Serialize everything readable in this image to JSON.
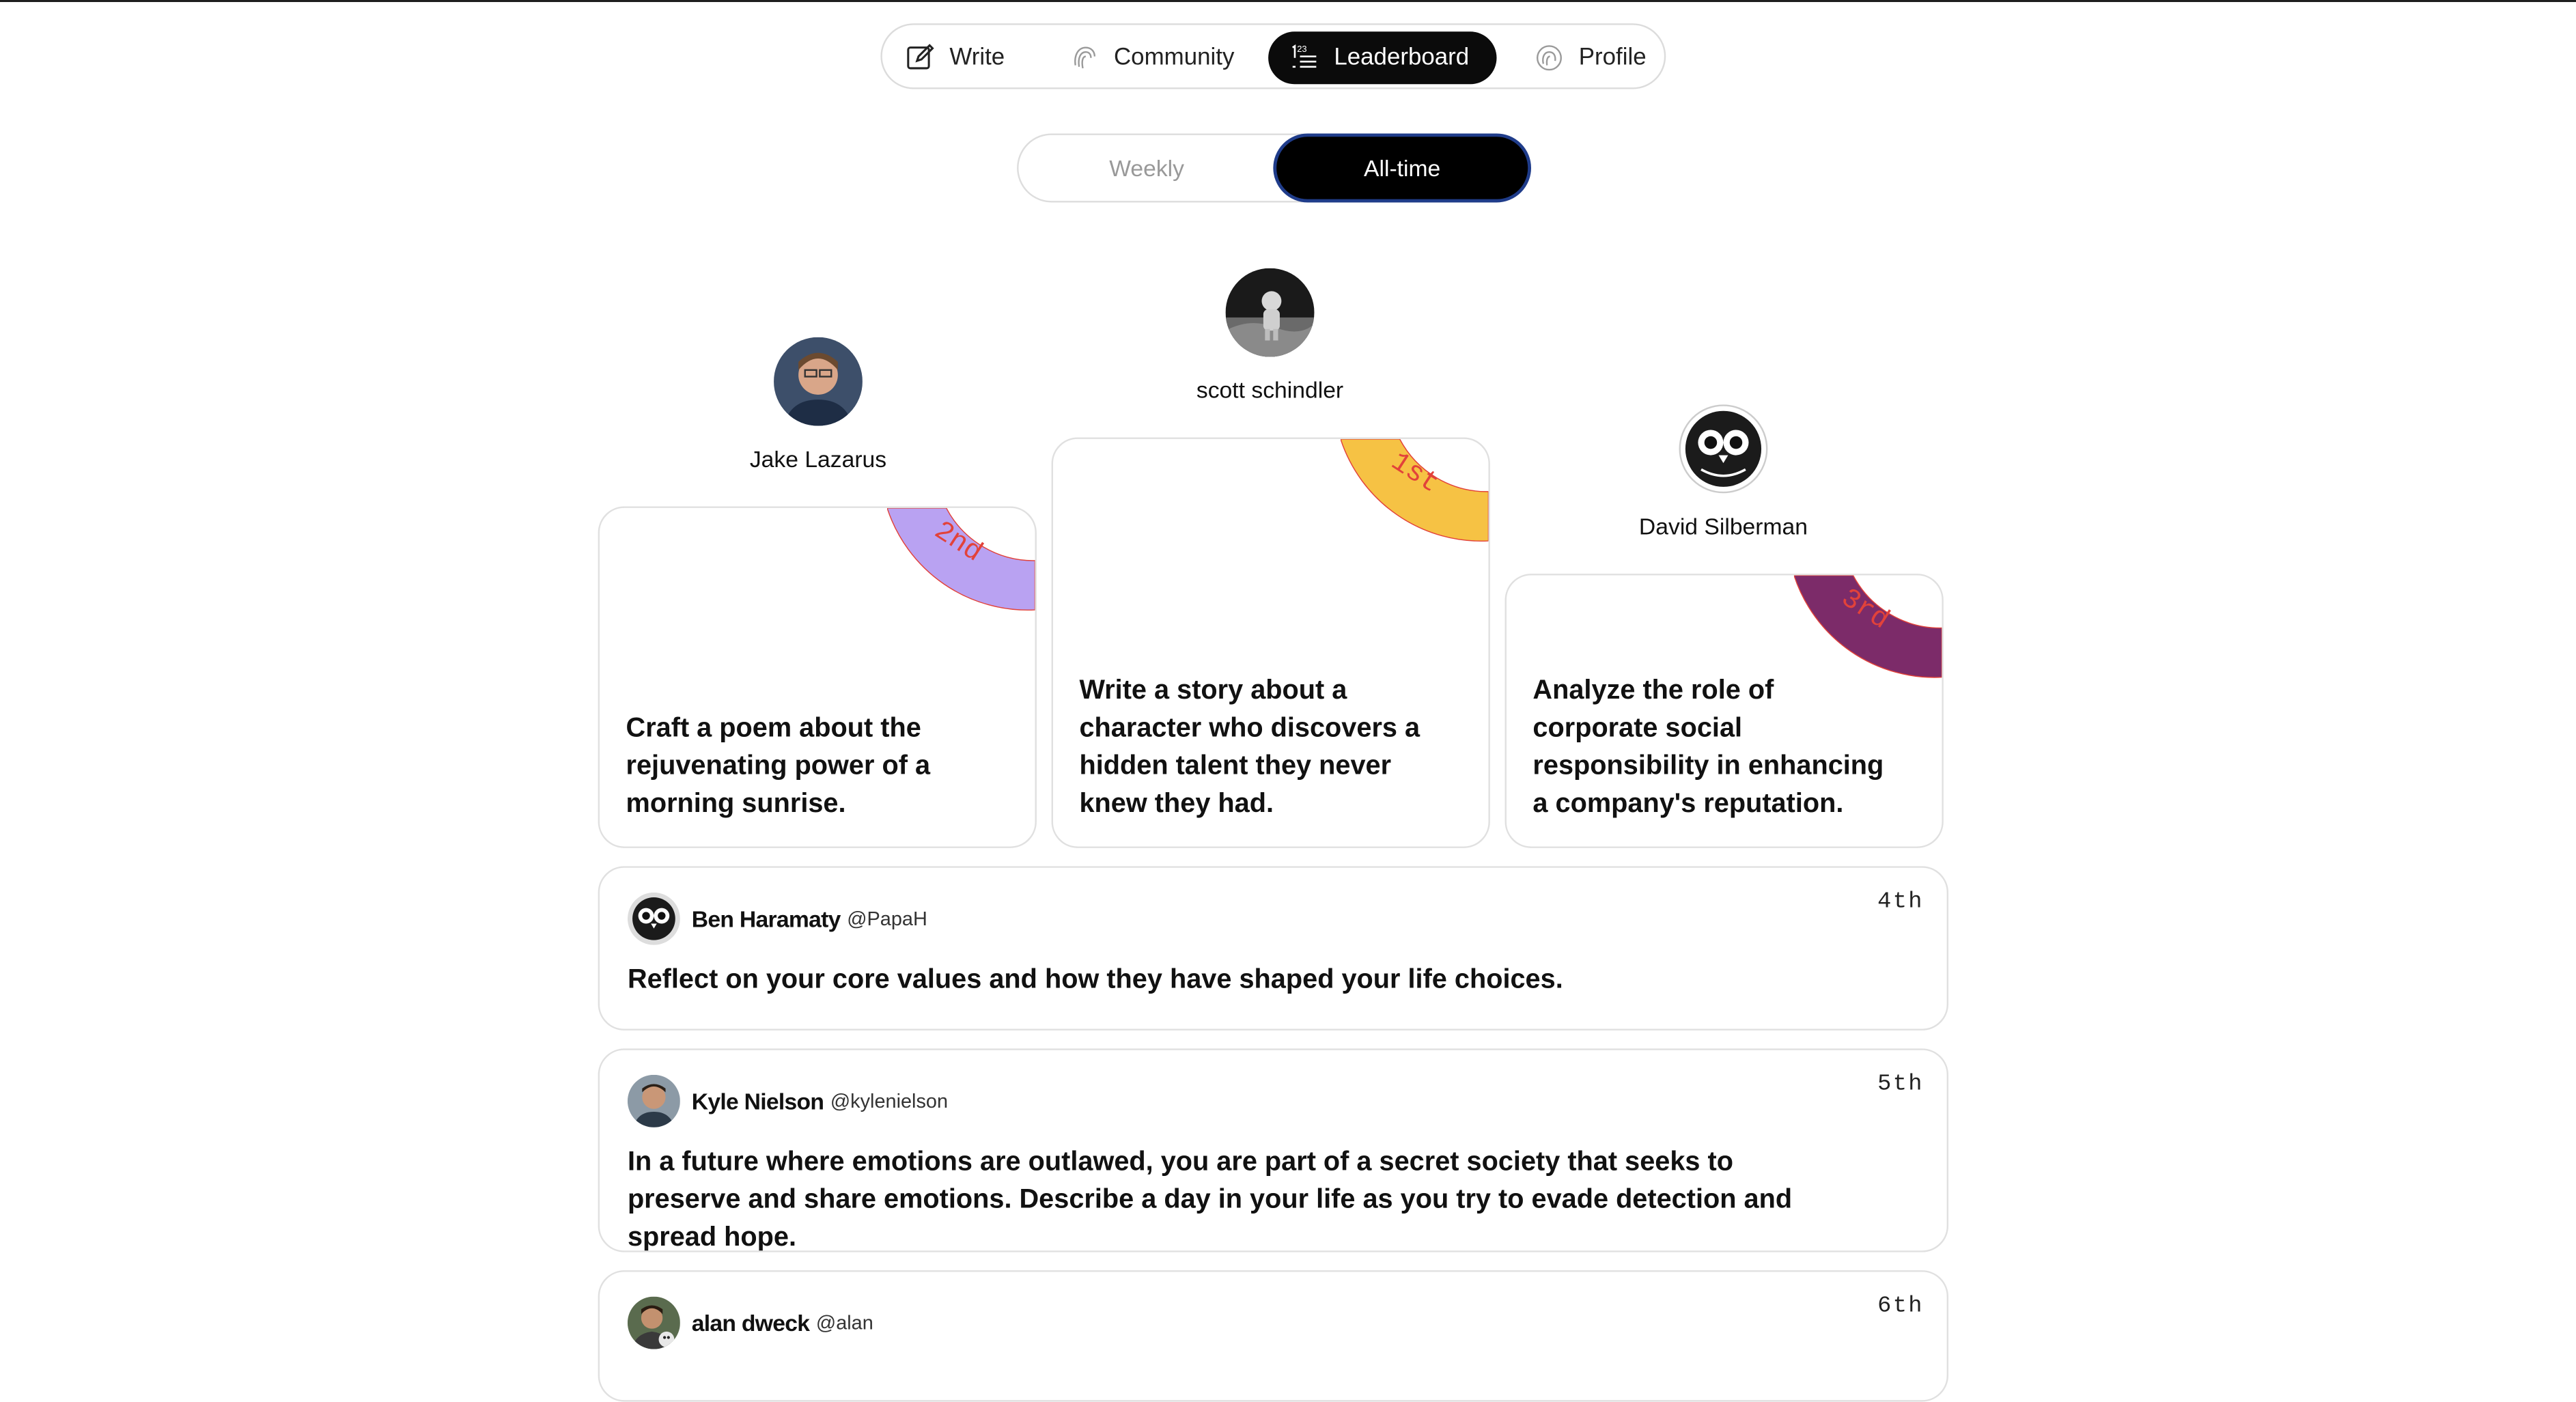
{
  "nav": {
    "items": [
      {
        "label": "Write",
        "icon": "pencil-square-icon",
        "active": false
      },
      {
        "label": "Community",
        "icon": "fingerprint-icon",
        "active": false
      },
      {
        "label": "Leaderboard",
        "icon": "ranking-list-icon",
        "active": true
      },
      {
        "label": "Profile",
        "icon": "fingerprint-icon",
        "active": false
      }
    ]
  },
  "period": {
    "options": [
      "Weekly",
      "All-time"
    ],
    "selected": "All-time"
  },
  "podium": {
    "first": {
      "name": "scott schindler",
      "rank": "1st",
      "ribbon_color": "#f6c244",
      "prompt": "Write a story about a character who discovers a hidden talent they never knew they had."
    },
    "second": {
      "name": "Jake Lazarus",
      "rank": "2nd",
      "ribbon_color": "#b9a2f2",
      "prompt": "Craft a poem about the rejuvenating power of a morning sunrise."
    },
    "third": {
      "name": "David Silberman",
      "rank": "3rd",
      "ribbon_color": "#7c2b69",
      "prompt": "Analyze the role of corporate social responsibility in enhancing a company's reputation."
    }
  },
  "rows": [
    {
      "name": "Ben Haramaty",
      "handle": "@PapaH",
      "rank": "4th",
      "prompt": "Reflect on your core values and how they have shaped your life choices."
    },
    {
      "name": "Kyle Nielson",
      "handle": "@kylenielson",
      "rank": "5th",
      "prompt": "In a future where emotions are outlawed, you are part of a secret society that seeks to preserve and share emotions. Describe a day in your life as you try to evade detection and spread hope."
    },
    {
      "name": "alan dweck",
      "handle": "@alan",
      "rank": "6th",
      "prompt": ""
    }
  ],
  "colors": {
    "accent": "#000000",
    "ribbon_text": "#e2423a",
    "active_outline": "#1f3c8a"
  }
}
